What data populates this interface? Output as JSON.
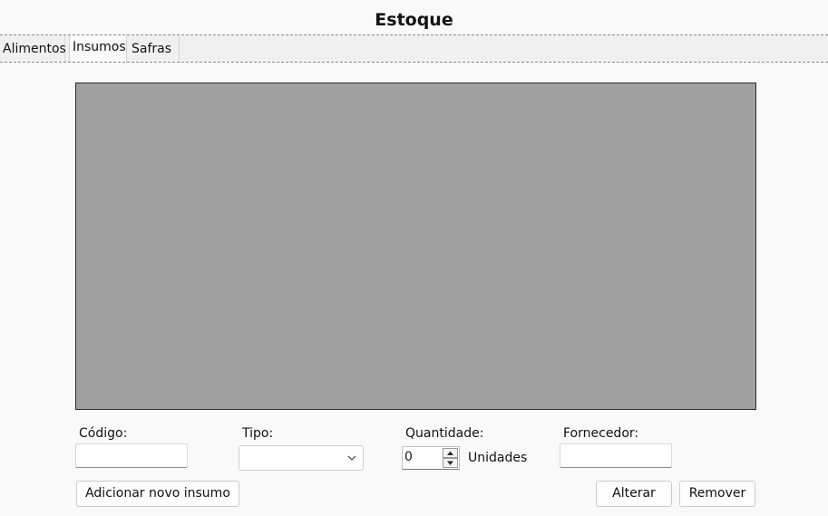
{
  "window": {
    "title": "Estoque"
  },
  "tabs": [
    {
      "label": "Alimentos",
      "active": false
    },
    {
      "label": "Insumos",
      "active": true
    },
    {
      "label": "Safras",
      "active": false
    }
  ],
  "form": {
    "codigo": {
      "label": "Código:",
      "value": ""
    },
    "tipo": {
      "label": "Tipo:",
      "selected": ""
    },
    "quantidade": {
      "label": "Quantidade:",
      "value": "0",
      "unit": "Unidades"
    },
    "fornecedor": {
      "label": "Fornecedor:",
      "value": ""
    }
  },
  "buttons": {
    "add": "Adicionar novo insumo",
    "alter": "Alterar",
    "remove": "Remover"
  },
  "icons": {
    "combo_arrow": "chevron-down-icon",
    "spin_up": "triangle-up-icon",
    "spin_down": "triangle-down-icon"
  },
  "colors": {
    "table_background": "#a0a0a0",
    "window_background": "#f9f9f9"
  }
}
